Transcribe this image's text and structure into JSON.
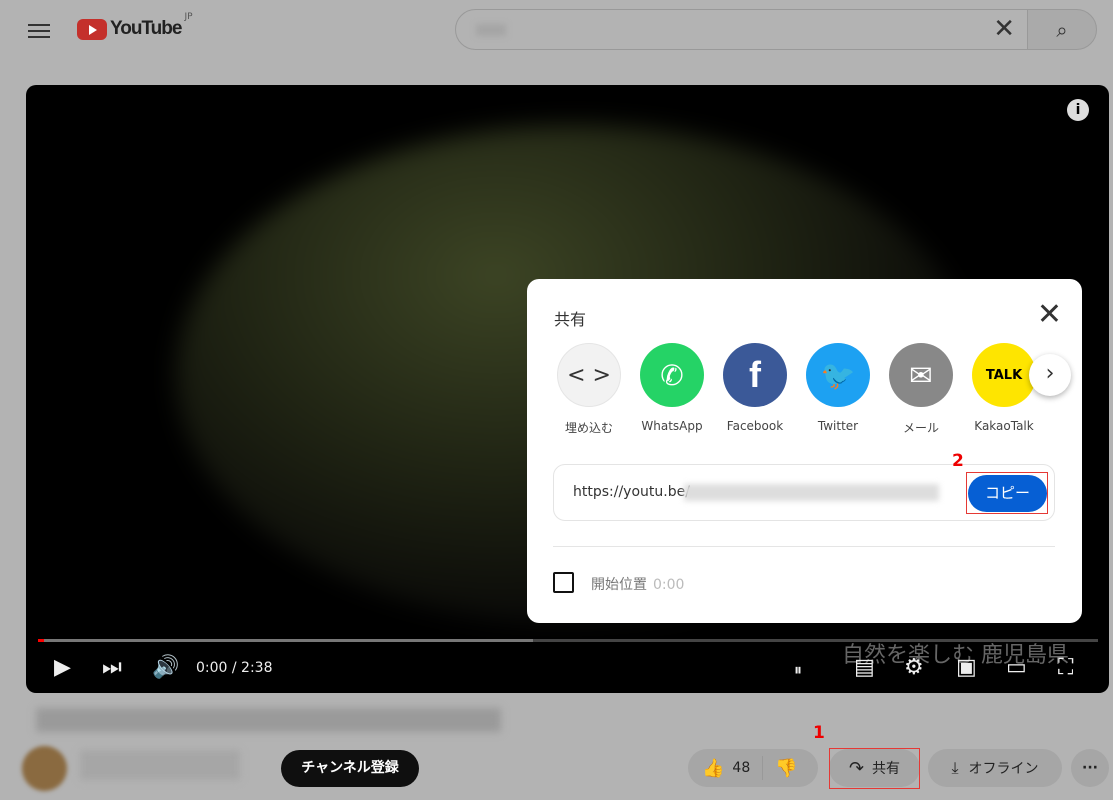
{
  "header": {
    "logo_text": "YouTube",
    "region": "JP"
  },
  "player": {
    "time": "0:00 / 2:38",
    "watermark": "自然を楽しむ 鹿児島県",
    "progress_fraction": 0.0
  },
  "share_dialog": {
    "title": "共有",
    "targets": [
      {
        "label": "埋め込む",
        "icon": "embed-code-icon",
        "color": "#f2f2f2"
      },
      {
        "label": "WhatsApp",
        "icon": "whatsapp-icon",
        "color": "#25d366"
      },
      {
        "label": "Facebook",
        "icon": "facebook-icon",
        "color": "#3b5998"
      },
      {
        "label": "Twitter",
        "icon": "twitter-icon",
        "color": "#1da1f2"
      },
      {
        "label": "メール",
        "icon": "mail-icon",
        "color": "#888888"
      },
      {
        "label": "KakaoTalk",
        "icon": "kakaotalk-icon",
        "color": "#fee500"
      }
    ],
    "url": "https://youtu.be/",
    "copy_label": "コピー",
    "start_label": "開始位置",
    "start_time": "0:00"
  },
  "annotations": {
    "one": "1",
    "two": "2"
  },
  "actions": {
    "likes": "48",
    "share": "共有",
    "offline": "オフライン",
    "subscribe": "チャンネル登録",
    "more": "···"
  }
}
